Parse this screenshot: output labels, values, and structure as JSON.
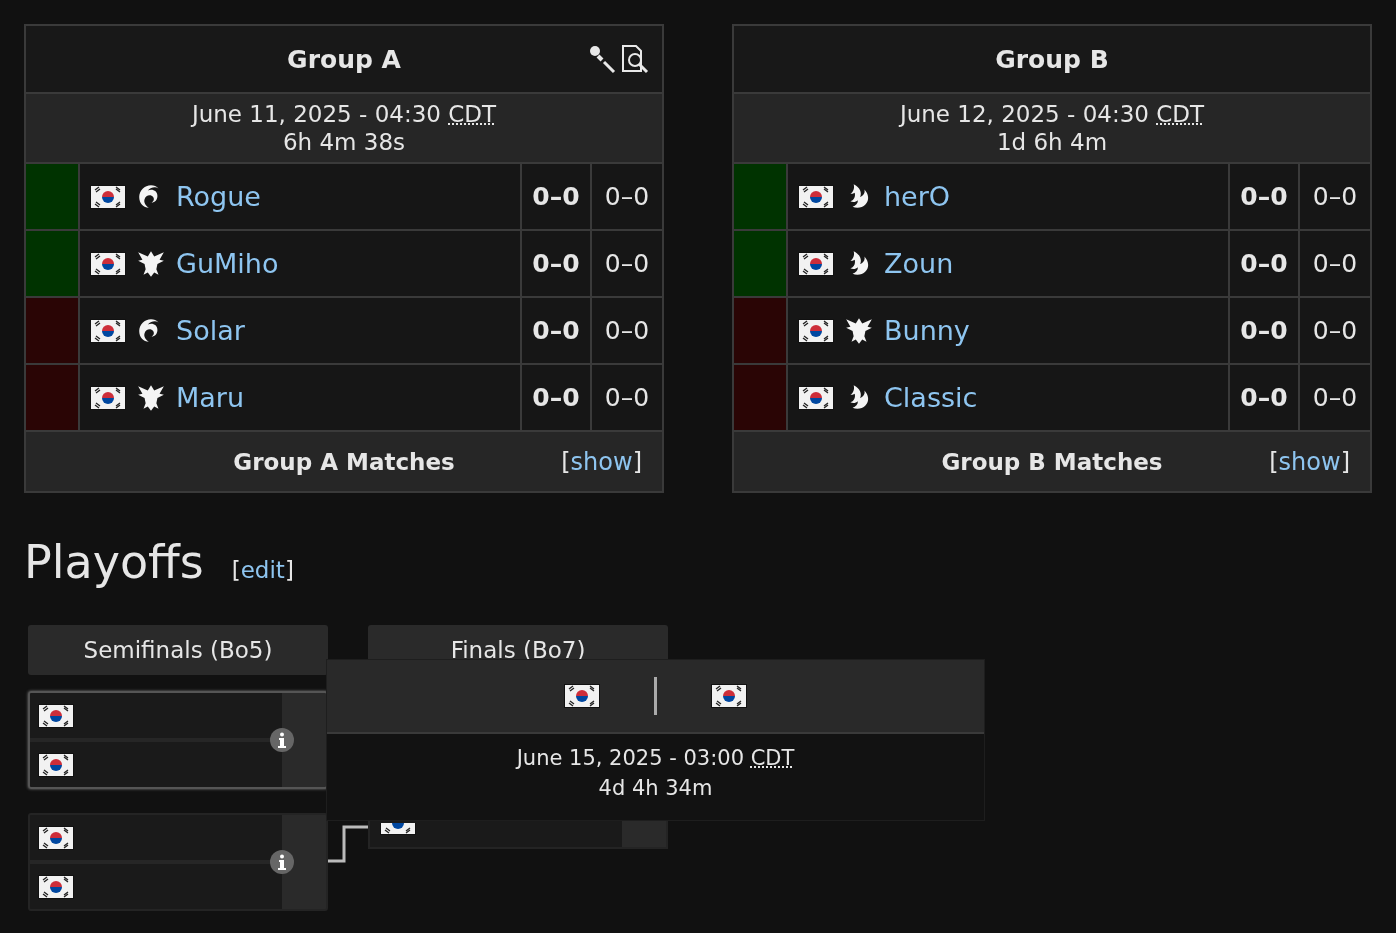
{
  "groups": [
    {
      "title": "Group A",
      "tools": true,
      "date": "June 11, 2025 - 04:30",
      "timezone": "CDT",
      "countdown": "6h 4m 38s",
      "players": [
        {
          "kind": "zerg",
          "name": "Rogue",
          "color": "#003300",
          "series_score": "0–0",
          "game_score": "0–0"
        },
        {
          "kind": "terran",
          "name": "GuMiho",
          "color": "#003300",
          "series_score": "0–0",
          "game_score": "0–0"
        },
        {
          "kind": "zerg",
          "name": "Solar",
          "color": "#2a0505",
          "series_score": "0–0",
          "game_score": "0–0"
        },
        {
          "kind": "terran",
          "name": "Maru",
          "color": "#2a0505",
          "series_score": "0–0",
          "game_score": "0–0"
        }
      ],
      "matches_label": "Group A Matches",
      "toggle": {
        "open": "[",
        "label": "show",
        "close": "]"
      }
    },
    {
      "title": "Group B",
      "tools": false,
      "date": "June 12, 2025 - 04:30",
      "timezone": "CDT",
      "countdown": "1d 6h 4m",
      "players": [
        {
          "kind": "protoss",
          "name": "herO",
          "color": "#003300",
          "series_score": "0–0",
          "game_score": "0–0"
        },
        {
          "kind": "protoss",
          "name": "Zoun",
          "color": "#003300",
          "series_score": "0–0",
          "game_score": "0–0"
        },
        {
          "kind": "terran",
          "name": "Bunny",
          "color": "#2a0505",
          "series_score": "0–0",
          "game_score": "0–0"
        },
        {
          "kind": "protoss",
          "name": "Classic",
          "color": "#2a0505",
          "series_score": "0–0",
          "game_score": "0–0"
        }
      ],
      "matches_label": "Group B Matches",
      "toggle": {
        "open": "[",
        "label": "show",
        "close": "]"
      }
    }
  ],
  "playoffs": {
    "title": "Playoffs",
    "edit_link": {
      "open": "[",
      "label": "edit",
      "close": "]"
    },
    "semifinals": {
      "title": "Semifinals (Bo5)",
      "matches": [
        {
          "highlighted": true,
          "players": [
            {
              "kind": "flag"
            },
            {
              "kind": "flag"
            }
          ]
        },
        {
          "highlighted": false,
          "players": [
            {
              "kind": "flag"
            },
            {
              "kind": "flag"
            }
          ]
        }
      ]
    },
    "finals": {
      "title": "Finals (Bo7)",
      "players": [
        {
          "kind": "flag"
        }
      ]
    },
    "popup": {
      "players": [
        {
          "kind": "flag"
        },
        {
          "kind": "flag"
        }
      ],
      "date": "June 15, 2025 - 03:00",
      "timezone": "CDT",
      "countdown": "4d 4h 34m"
    }
  }
}
